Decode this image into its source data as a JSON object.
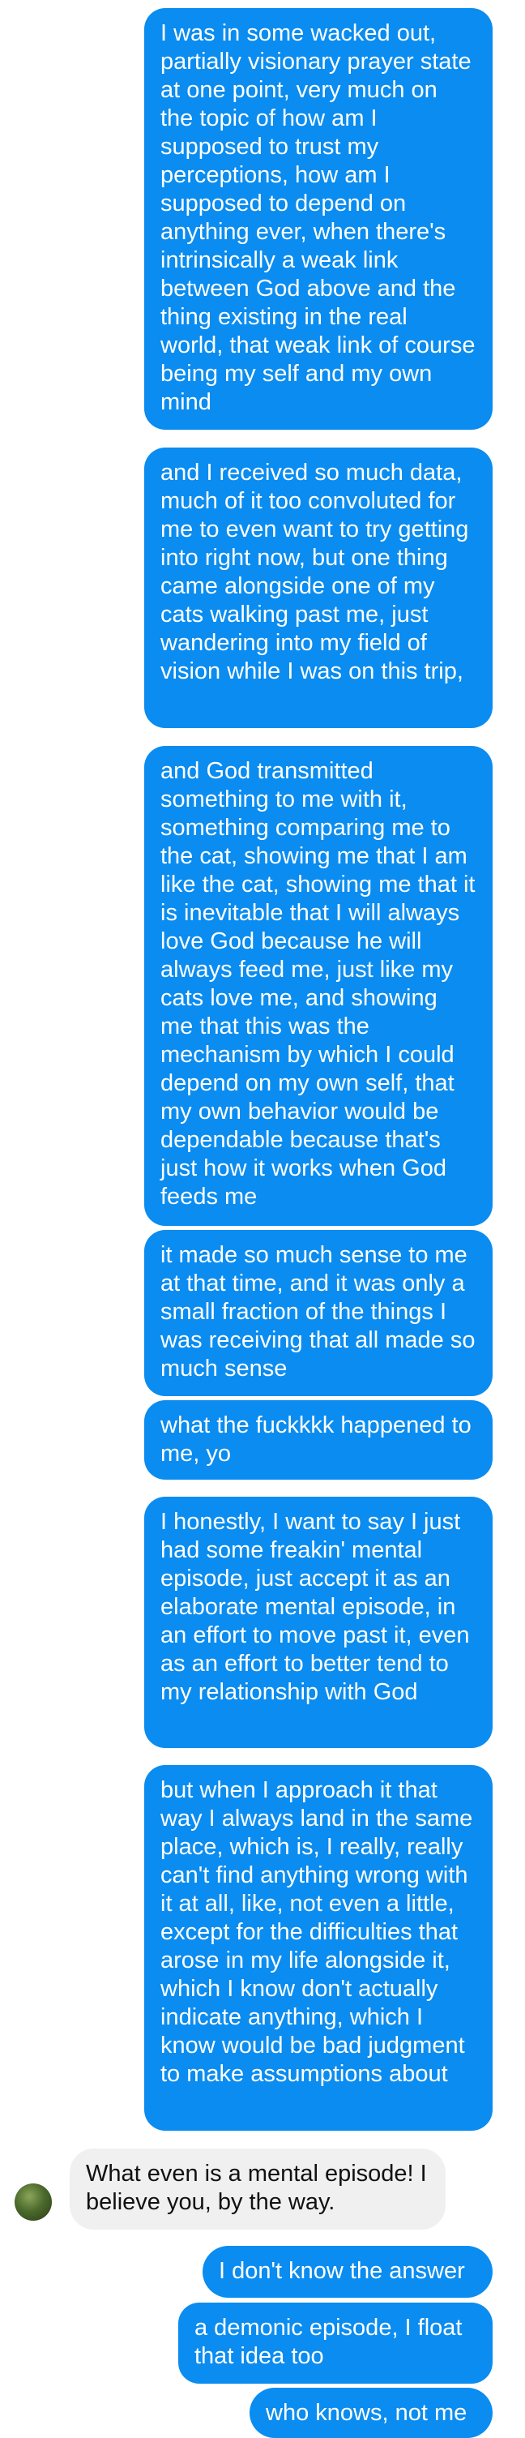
{
  "messages": [
    {
      "sender": "me",
      "text": "I was in some wacked out, partially visionary prayer state at one point, very much on the topic of how am I supposed to trust my perceptions, how am I supposed to depend on anything ever, when there's intrinsically a weak link between God above and the thing existing in the real world, that weak link of course being my self and my own mind"
    },
    {
      "sender": "me",
      "text": "and I received so much data, much of it too convoluted for me to even want to try getting into right now, but one thing came alongside one of my cats walking past me, just wandering into my field of vision while I was on this trip,"
    },
    {
      "sender": "me",
      "text": "and God transmitted something to me with it, something comparing me to the cat, showing me that I am like the cat, showing me that it is inevitable that I will always love God because he will always feed me, just like my cats love me, and showing me that this was the mechanism by which I could depend on my own self, that my own behavior would be dependable because that's just how it works when God feeds me"
    },
    {
      "sender": "me",
      "text": "it made so much sense to me at that time, and it was only a small fraction of the things I was receiving that all made so much sense"
    },
    {
      "sender": "me",
      "text": "what the fuckkkk happened to me, yo"
    },
    {
      "sender": "me",
      "text": "I honestly, I want to say I just had some freakin' mental episode, just accept it as an elaborate mental episode, in an effort to move past it, even as an effort to better tend to my relationship with God"
    },
    {
      "sender": "me",
      "text": "but when I approach it that way I always land in the same place, which is, I really, really can't find anything wrong with it at all, like, not even a little, except for the difficulties that arose in my life alongside it, which I know don't actually indicate anything, which I know would be bad judgment to make assumptions about"
    },
    {
      "sender": "them",
      "text": "What even is a mental episode! I believe you, by the way."
    },
    {
      "sender": "me",
      "text": "I don't know the answer"
    },
    {
      "sender": "me",
      "text": "a demonic episode, I float that idea too"
    },
    {
      "sender": "me",
      "text": "who knows, not me"
    }
  ],
  "colors": {
    "outgoing_bubble": "#0a8cf0",
    "outgoing_text": "#ffffff",
    "incoming_bubble": "#f0f0f0",
    "incoming_text": "#111111"
  }
}
